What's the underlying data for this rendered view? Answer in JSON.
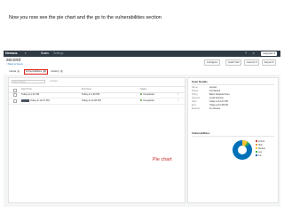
{
  "heading": "Now you now see the pie chart and the go to the vulnerabilities section",
  "topbar": {
    "logo": "Nessus",
    "logo_suffix": "▾",
    "nav": [
      "Scans",
      "Settings"
    ],
    "user": "rvagman ▾"
  },
  "title": {
    "text": "second",
    "back_link": "< Back to Scans"
  },
  "actions": [
    "Configure",
    "Audit Trail",
    "Launch ▾",
    "Export ▾"
  ],
  "tabs": [
    {
      "label": "Hosts",
      "count": "1"
    },
    {
      "label": "Vulnerabilities",
      "count": "23"
    },
    {
      "label": "History",
      "count": "2"
    }
  ],
  "filter": {
    "placeholder": "Filter History",
    "count": "2 Scans"
  },
  "table": {
    "columns": [
      "Start Time",
      "End Time",
      "Status"
    ],
    "rows": [
      {
        "start": "Today at 1:11 PM",
        "end": "Today at 1:30 PM",
        "status": "Completed"
      },
      {
        "start": "Today at 12:27 PM",
        "end": "Today at 12:38 PM",
        "status": "Completed"
      }
    ]
  },
  "scan_details": {
    "title": "Scan Details",
    "fields": [
      {
        "key": "Name:",
        "value": "second"
      },
      {
        "key": "Status:",
        "value": "Completed"
      },
      {
        "key": "Policy:",
        "value": "Basic Network Scan"
      },
      {
        "key": "Scanner:",
        "value": "Local Scanner"
      },
      {
        "key": "Start:",
        "value": "Today at 12:27 PM"
      },
      {
        "key": "End:",
        "value": "Today at 12:38 PM"
      },
      {
        "key": "Elapsed:",
        "value": "11 minutes"
      }
    ]
  },
  "vulnerabilities": {
    "title": "Vulnerabilities",
    "legend": [
      "Critical",
      "High",
      "Medium",
      "Low",
      "Info"
    ]
  },
  "annotation": {
    "pie_label": "Pie chart"
  },
  "colors": {
    "critical": "#d43f3a",
    "high": "#ee9336",
    "medium": "#fdc431",
    "low": "#3fae49",
    "info": "#0071b9",
    "highlight": "#e2231a"
  }
}
